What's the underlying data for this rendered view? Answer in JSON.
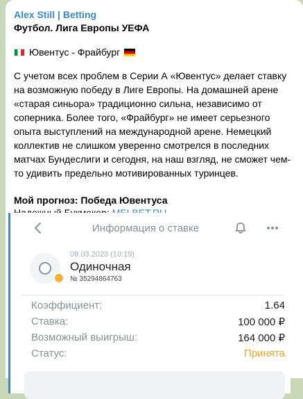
{
  "message": {
    "sender": "Alex Still | Betting",
    "title": "Футбол. Лига Европы УЕФА",
    "match": "Ювентус - Фрайбург",
    "paragraph": "С учетом всех проблем в Серии А «Ювентус» делает ставку на возможную победу в Лиге Европы. На домашней арене «старая синьора» традиционно сильна, независимо от соперника. Более того, «Фрайбург» не имеет серьезного опыта выступлений на международной арене. Немецкий коллектив не слишком уверенно смотрелся в последних матчах Бундеслиги и сегодня, на наш взгляд, не сможет чем-то удивить предельно мотивированных туринцев.",
    "forecast": "Мой прогноз: Победа Ювентуса",
    "bookmaker_label": "Надежный Букмекер:",
    "bookmaker_link": "MELBET.RU"
  },
  "bet_screen": {
    "title": "Информация о ставке",
    "date": "09.03.2023 (10:19)",
    "type": "Одиночная",
    "number": "№ 35294864763",
    "rows": [
      {
        "label": "Коэффициент:",
        "value": "1.64"
      },
      {
        "label": "Ставка:",
        "value": "100 000 ₽"
      },
      {
        "label": "Возможный выигрыш:",
        "value": "164 000 ₽"
      },
      {
        "label": "Статус:",
        "value": "Принята"
      }
    ]
  },
  "colors": {
    "accent": "#3a8ac8",
    "status": "#e6a628",
    "background": "#c9d7b9"
  }
}
